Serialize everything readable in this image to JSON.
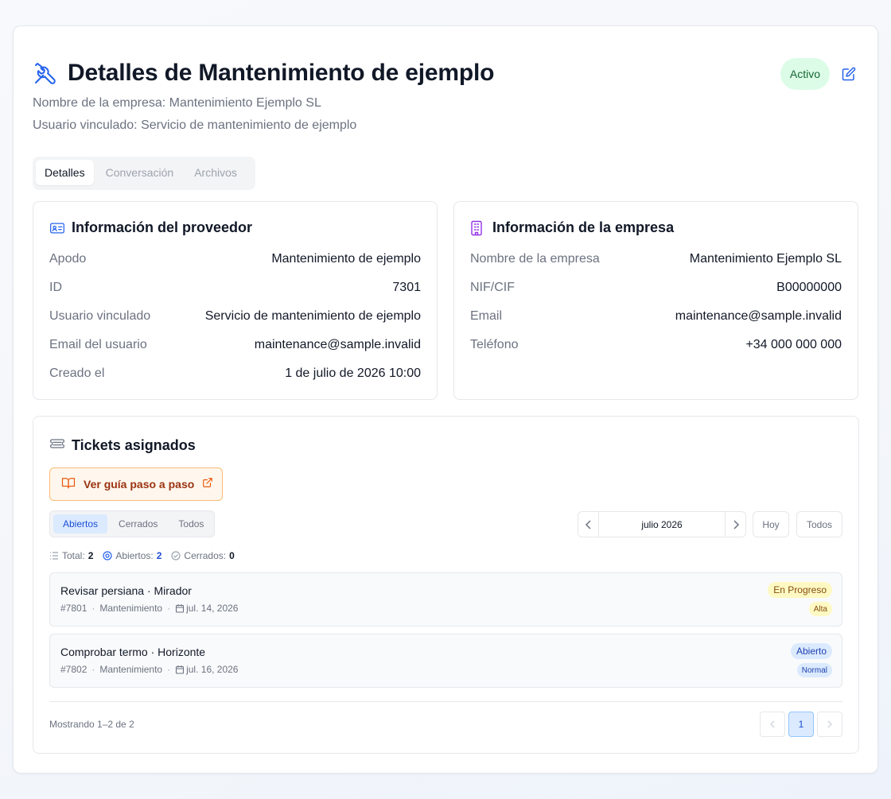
{
  "header": {
    "title": "Detalles de Mantenimiento de ejemplo",
    "company_line": "Nombre de la empresa: Mantenimiento Ejemplo SL",
    "user_line": "Usuario vinculado: Servicio de mantenimiento de ejemplo",
    "status": "Activo",
    "title_icon": "wrench-screwdriver-icon",
    "edit_icon": "edit-icon"
  },
  "tabs": [
    {
      "label": "Detalles",
      "active": true
    },
    {
      "label": "Conversación",
      "active": false
    },
    {
      "label": "Archivos",
      "active": false
    }
  ],
  "provider": {
    "title": "Información del proveedor",
    "icon": "id-card-icon",
    "rows": [
      {
        "key": "Apodo",
        "value": "Mantenimiento de ejemplo"
      },
      {
        "key": "ID",
        "value": "7301"
      },
      {
        "key": "Usuario vinculado",
        "value": "Servicio de mantenimiento de ejemplo"
      },
      {
        "key": "Email del usuario",
        "value": "maintenance@sample.invalid"
      },
      {
        "key": "Creado el",
        "value": "1 de julio de 2026 10:00"
      }
    ]
  },
  "company": {
    "title": "Información de la empresa",
    "icon": "building-icon",
    "rows": [
      {
        "key": "Nombre de la empresa",
        "value": "Mantenimiento Ejemplo SL"
      },
      {
        "key": "NIF/CIF",
        "value": "B00000000"
      },
      {
        "key": "Email",
        "value": "maintenance@sample.invalid"
      },
      {
        "key": "Teléfono",
        "value": "+34 000 000 000"
      }
    ]
  },
  "tickets": {
    "title": "Tickets asignados",
    "guide_label": "Ver guía paso a paso",
    "filters": [
      {
        "label": "Abiertos",
        "active": true
      },
      {
        "label": "Cerrados",
        "active": false
      },
      {
        "label": "Todos",
        "active": false
      }
    ],
    "month": "julio 2026",
    "today_label": "Hoy",
    "all_label": "Todos",
    "stats": {
      "total_label": "Total:",
      "total": "2",
      "open_label": "Abiertos:",
      "open": "2",
      "closed_label": "Cerrados:",
      "closed": "0"
    },
    "items": [
      {
        "title": "Revisar persiana · Mirador",
        "number": "#7801",
        "category": "Mantenimiento",
        "date": "jul. 14, 2026",
        "status": "En Progreso",
        "priority": "Alta"
      },
      {
        "title": "Comprobar termo · Horizonte",
        "number": "#7802",
        "category": "Mantenimiento",
        "date": "jul. 16, 2026",
        "status": "Abierto",
        "priority": "Normal"
      }
    ],
    "footer": "Mostrando 1–2 de 2",
    "current_page": "1"
  },
  "colors": {
    "accent": "#2563eb",
    "status_active_bg": "#dcfce7",
    "guide_bg": "#fff7ed",
    "guide_text": "#9a3412"
  }
}
